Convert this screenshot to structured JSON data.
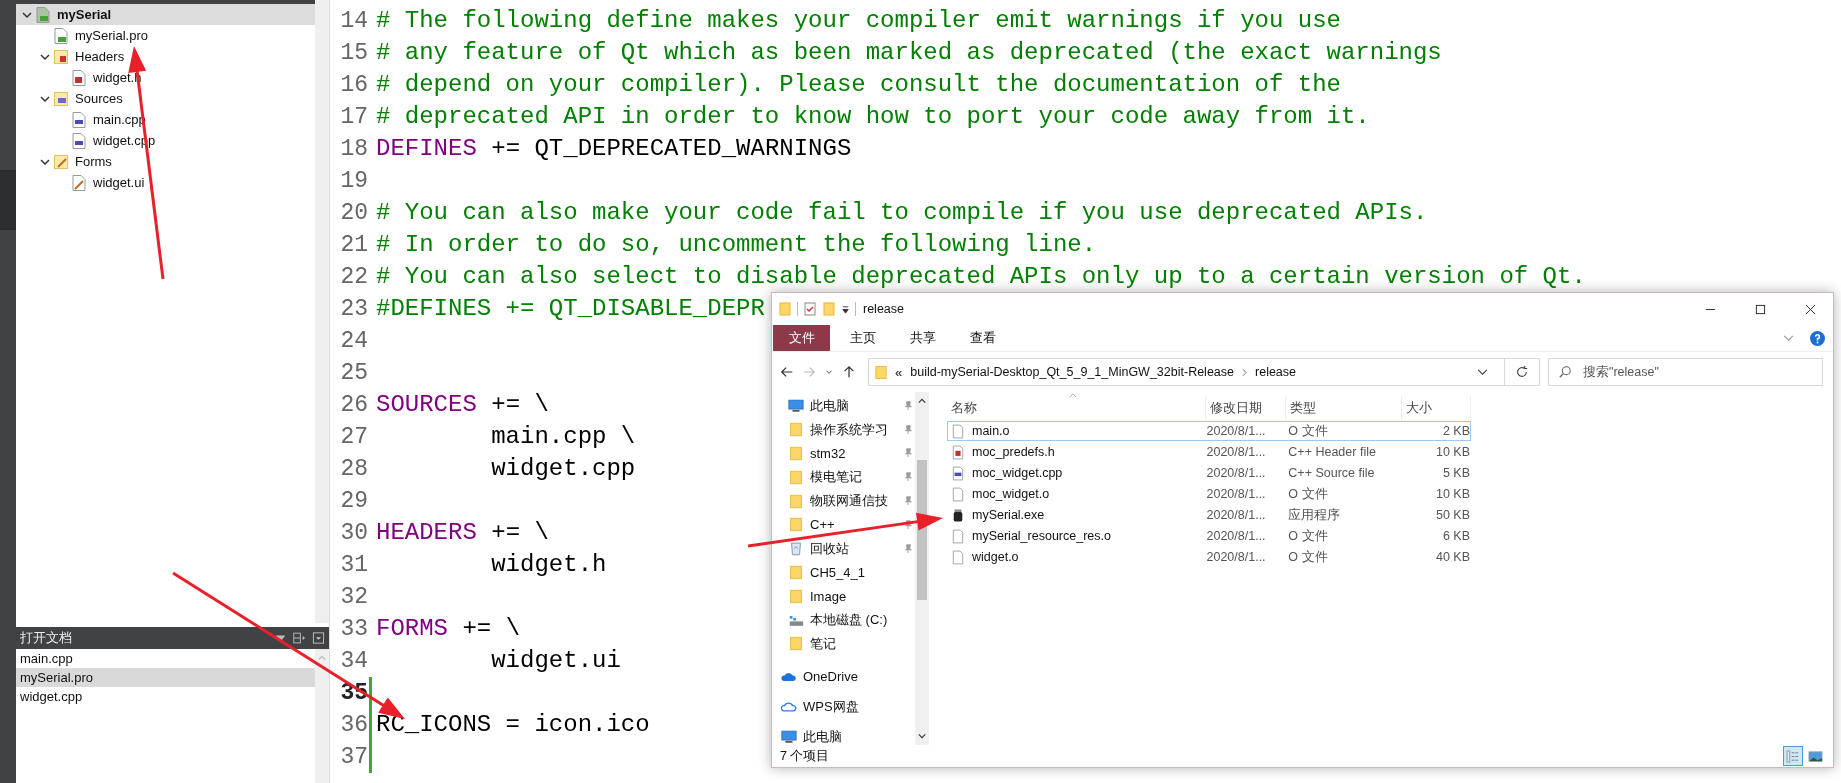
{
  "project_tree": {
    "items": [
      {
        "label": "mySerial",
        "kind": "project",
        "selected": true,
        "expanded": true,
        "children": [
          {
            "label": "mySerial.pro",
            "kind": "pro-file",
            "selected": false
          },
          {
            "label": "Headers",
            "kind": "header-folder",
            "selected": false,
            "expanded": true,
            "children": [
              {
                "label": "widget.h",
                "kind": "header-file",
                "selected": false
              }
            ]
          },
          {
            "label": "Sources",
            "kind": "source-folder",
            "selected": false,
            "expanded": true,
            "children": [
              {
                "label": "main.cpp",
                "kind": "source-file",
                "selected": false
              },
              {
                "label": "widget.cpp",
                "kind": "source-file",
                "selected": false
              }
            ]
          },
          {
            "label": "Forms",
            "kind": "form-folder",
            "selected": false,
            "expanded": true,
            "children": [
              {
                "label": "widget.ui",
                "kind": "form-file",
                "selected": false
              }
            ]
          }
        ]
      }
    ]
  },
  "open_documents": {
    "title": "打开文档",
    "items": [
      {
        "label": "main.cpp",
        "selected": false
      },
      {
        "label": "mySerial.pro",
        "selected": true
      },
      {
        "label": "widget.cpp",
        "selected": false
      }
    ]
  },
  "editor": {
    "lines": [
      {
        "number": "14",
        "kind": "comment",
        "text": "# The following define makes your compiler emit warnings if you use",
        "current": false,
        "changed": false
      },
      {
        "number": "15",
        "kind": "comment",
        "text": "# any feature of Qt which as been marked as deprecated (the exact warnings",
        "current": false,
        "changed": false
      },
      {
        "number": "16",
        "kind": "comment",
        "text": "# depend on your compiler). Please consult the documentation of the",
        "current": false,
        "changed": false
      },
      {
        "number": "17",
        "kind": "comment",
        "text": "# deprecated API in order to know how to port your code away from it.",
        "current": false,
        "changed": false
      },
      {
        "number": "18",
        "kind": "keyword",
        "keyword": "DEFINES",
        "text": " += QT_DEPRECATED_WARNINGS",
        "current": false,
        "changed": false
      },
      {
        "number": "19",
        "kind": "blank",
        "current": false,
        "changed": false
      },
      {
        "number": "20",
        "kind": "comment",
        "text": "# You can also make your code fail to compile if you use deprecated APIs.",
        "current": false,
        "changed": false
      },
      {
        "number": "21",
        "kind": "comment",
        "text": "# In order to do so, uncomment the following line.",
        "current": false,
        "changed": false
      },
      {
        "number": "22",
        "kind": "comment",
        "text": "# You can also select to disable deprecated APIs only up to a certain version of Qt.",
        "current": false,
        "changed": false
      },
      {
        "number": "23",
        "kind": "comment",
        "text": "#DEFINES += QT_DISABLE_DEPR",
        "current": false,
        "changed": false
      },
      {
        "number": "24",
        "kind": "blank",
        "current": false,
        "changed": false
      },
      {
        "number": "25",
        "kind": "blank",
        "current": false,
        "changed": false
      },
      {
        "number": "26",
        "kind": "keyword",
        "keyword": "SOURCES",
        "text": " += \\",
        "current": false,
        "changed": false
      },
      {
        "number": "27",
        "kind": "plain",
        "text": "        main.cpp \\",
        "current": false,
        "changed": false
      },
      {
        "number": "28",
        "kind": "plain",
        "text": "        widget.cpp",
        "current": false,
        "changed": false
      },
      {
        "number": "29",
        "kind": "blank",
        "current": false,
        "changed": false
      },
      {
        "number": "30",
        "kind": "keyword",
        "keyword": "HEADERS",
        "text": " += \\",
        "current": false,
        "changed": false
      },
      {
        "number": "31",
        "kind": "plain",
        "text": "        widget.h",
        "current": false,
        "changed": false
      },
      {
        "number": "32",
        "kind": "blank",
        "current": false,
        "changed": false
      },
      {
        "number": "33",
        "kind": "keyword",
        "keyword": "FORMS",
        "text": " += \\",
        "current": false,
        "changed": false
      },
      {
        "number": "34",
        "kind": "plain",
        "text": "        widget.ui",
        "current": false,
        "changed": false
      },
      {
        "number": "35",
        "kind": "blank",
        "current": true,
        "changed": true
      },
      {
        "number": "36",
        "kind": "plain",
        "text": "RC_ICONS = icon.ico",
        "current": false,
        "changed": true
      },
      {
        "number": "37",
        "kind": "blank",
        "current": false,
        "changed": true
      }
    ]
  },
  "explorer": {
    "title": "release",
    "ribbon_tabs": [
      {
        "label": "文件",
        "kind": "file-menu"
      },
      {
        "label": "主页",
        "kind": "tab"
      },
      {
        "label": "共享",
        "kind": "tab"
      },
      {
        "label": "查看",
        "kind": "tab"
      }
    ],
    "nav_buttons": [
      {
        "kind": "back",
        "disabled": false
      },
      {
        "kind": "forward",
        "disabled": true
      },
      {
        "kind": "recent",
        "disabled": false
      },
      {
        "kind": "up",
        "disabled": false
      }
    ],
    "address": {
      "overflow": "«",
      "segments": [
        "build-mySerial-Desktop_Qt_5_9_1_MinGW_32bit-Release",
        "release"
      ]
    },
    "search": {
      "placeholder": "搜索\"release\""
    },
    "nav_pane": [
      {
        "label": "此电脑",
        "kind": "pc",
        "pinned": true
      },
      {
        "label": "操作系统学习",
        "kind": "folder",
        "pinned": true
      },
      {
        "label": "stm32",
        "kind": "folder",
        "pinned": true
      },
      {
        "label": "模电笔记",
        "kind": "folder",
        "pinned": true
      },
      {
        "label": "物联网通信技",
        "kind": "folder",
        "pinned": true
      },
      {
        "label": "C++",
        "kind": "folder",
        "pinned": true
      },
      {
        "label": "回收站",
        "kind": "recycle",
        "pinned": true
      },
      {
        "label": "CH5_4_1",
        "kind": "folder",
        "pinned": false
      },
      {
        "label": "Image",
        "kind": "folder",
        "pinned": false
      },
      {
        "label": "本地磁盘 (C:)",
        "kind": "drive",
        "pinned": false
      },
      {
        "label": "笔记",
        "kind": "folder",
        "pinned": false
      },
      {
        "label": "OneDrive",
        "kind": "onedrive",
        "pinned": false
      },
      {
        "label": "WPS网盘",
        "kind": "wps",
        "pinned": false
      },
      {
        "label": "此电脑",
        "kind": "pc",
        "pinned": false
      }
    ],
    "columns": [
      "名称",
      "修改日期",
      "类型",
      "大小"
    ],
    "files": [
      {
        "name": "main.o",
        "kind": "file",
        "date": "2020/8/1...",
        "type": "O 文件",
        "size": "2 KB",
        "focused": true
      },
      {
        "name": "moc_predefs.h",
        "kind": "header",
        "date": "2020/8/1...",
        "type": "C++ Header file",
        "size": "10 KB",
        "focused": false
      },
      {
        "name": "moc_widget.cpp",
        "kind": "source",
        "date": "2020/8/1...",
        "type": "C++ Source file",
        "size": "5 KB",
        "focused": false
      },
      {
        "name": "moc_widget.o",
        "kind": "file",
        "date": "2020/8/1...",
        "type": "O 文件",
        "size": "10 KB",
        "focused": false
      },
      {
        "name": "mySerial.exe",
        "kind": "exe",
        "date": "2020/8/1...",
        "type": "应用程序",
        "size": "50 KB",
        "focused": false
      },
      {
        "name": "mySerial_resource_res.o",
        "kind": "file",
        "date": "2020/8/1...",
        "type": "O 文件",
        "size": "6 KB",
        "focused": false
      },
      {
        "name": "widget.o",
        "kind": "file",
        "date": "2020/8/1...",
        "type": "O 文件",
        "size": "40 KB",
        "focused": false
      }
    ],
    "status": "7 个项目",
    "view_buttons": [
      {
        "kind": "details",
        "selected": true
      },
      {
        "kind": "large-icons",
        "selected": false
      }
    ]
  },
  "annotations": [
    {
      "kind": "arrow",
      "color": "#e8202a"
    },
    {
      "kind": "arrow",
      "color": "#e8202a"
    },
    {
      "kind": "arrow",
      "color": "#e8202a"
    }
  ]
}
